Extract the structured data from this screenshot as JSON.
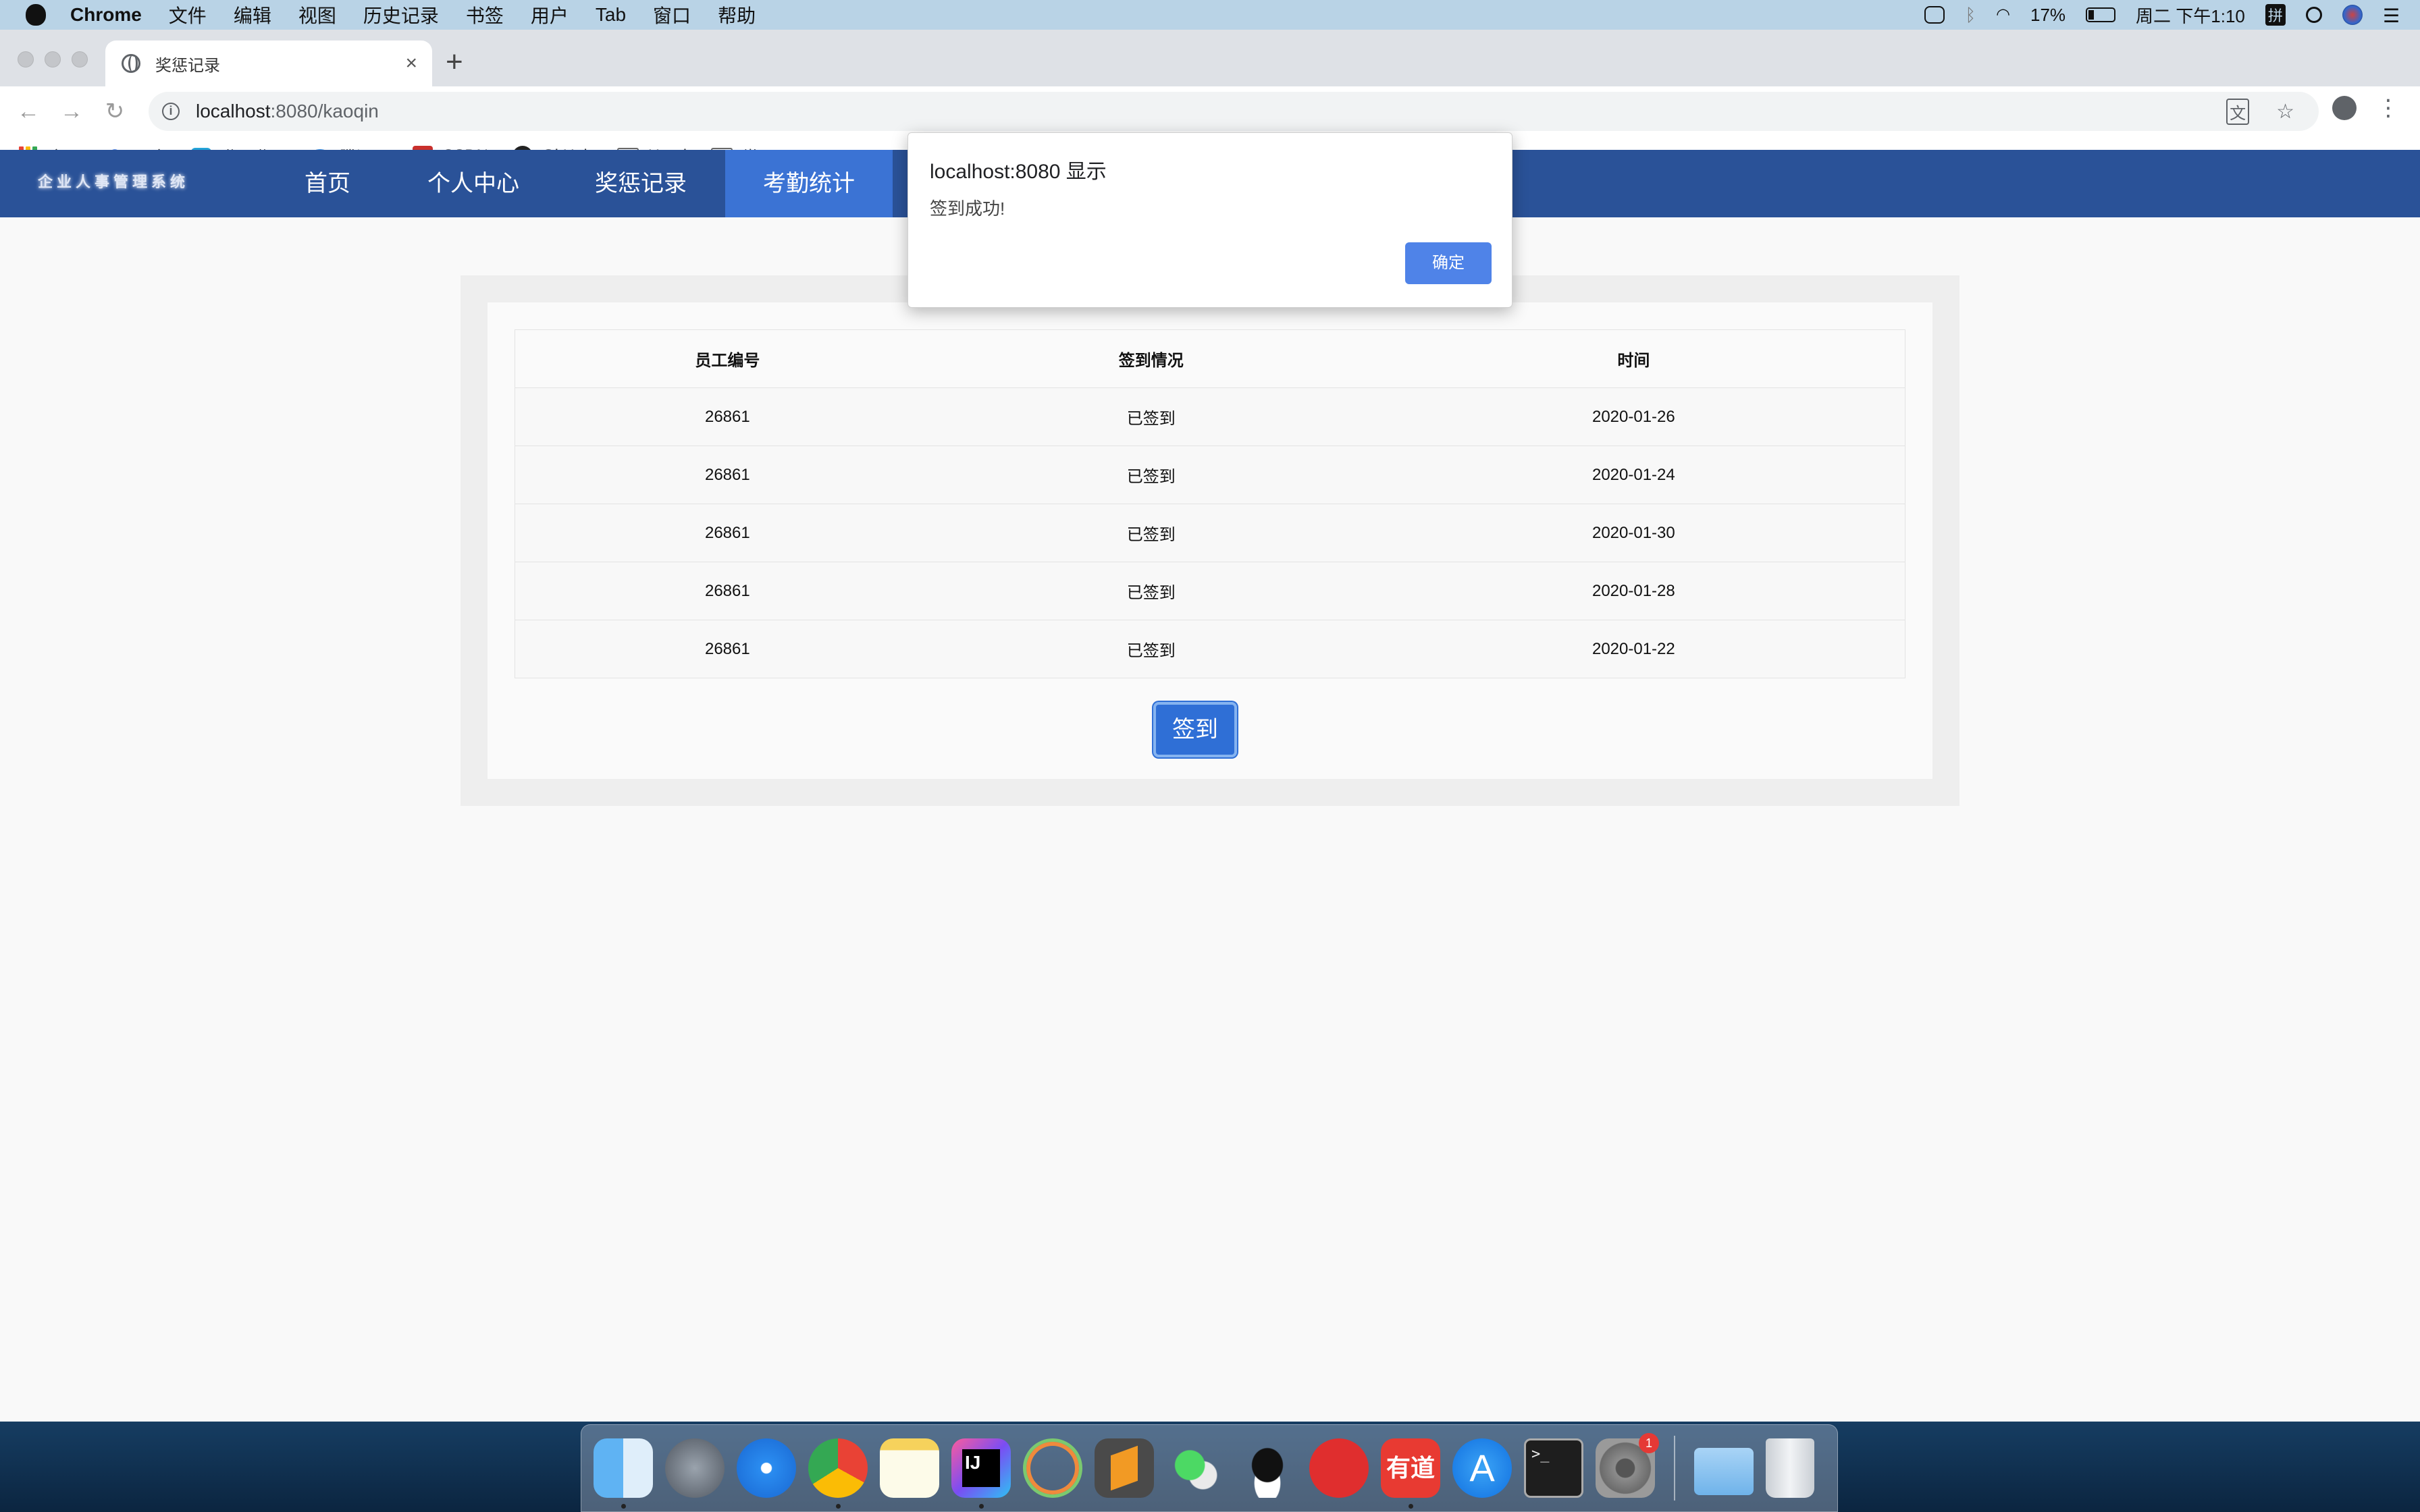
{
  "menubar": {
    "app_name": "Chrome",
    "menus": [
      "文件",
      "编辑",
      "视图",
      "历史记录",
      "书签",
      "用户",
      "Tab",
      "窗口",
      "帮助"
    ],
    "battery": "17%",
    "clock": "周二 下午1:10",
    "input_method": "拼"
  },
  "browser": {
    "tab_title": "奖惩记录",
    "url_host": "localhost",
    "url_rest": ":8080/kaoqin",
    "new_tab": "+",
    "close_tab": "×"
  },
  "bookmarks": [
    "应用",
    "百度",
    "哔哩哔哩",
    "腾讯云",
    "CSDN",
    "GitHub",
    "Hand",
    "常用工具"
  ],
  "site": {
    "logo_text": "企业人事管理系统",
    "nav": [
      "首页",
      "个人中心",
      "奖惩记录",
      "考勤统计"
    ],
    "active_nav": "考勤统计"
  },
  "table": {
    "headers": [
      "员工编号",
      "签到情况",
      "时间"
    ],
    "rows": [
      [
        "26861",
        "已签到",
        "2020-01-26"
      ],
      [
        "26861",
        "已签到",
        "2020-01-24"
      ],
      [
        "26861",
        "已签到",
        "2020-01-30"
      ],
      [
        "26861",
        "已签到",
        "2020-01-28"
      ],
      [
        "26861",
        "已签到",
        "2020-01-22"
      ]
    ]
  },
  "checkin_button": "签到",
  "dialog": {
    "title": "localhost:8080 显示",
    "message": "签到成功!",
    "ok": "确定"
  },
  "dock": {
    "apps": [
      "finder",
      "launchpad",
      "safari",
      "chrome",
      "notes",
      "intellij",
      "datagrip",
      "sublime",
      "wechat",
      "qq",
      "netease-music",
      "youdao",
      "app-store",
      "terminal",
      "system-preferences",
      "downloads",
      "trash"
    ],
    "system_preferences_badge": "1",
    "youdao_label": "有道"
  },
  "colors": {
    "navbar": "#2a5298",
    "nav_active": "#3b73d4",
    "button": "#2f6fd6",
    "dialog_button": "#4f83e8"
  }
}
